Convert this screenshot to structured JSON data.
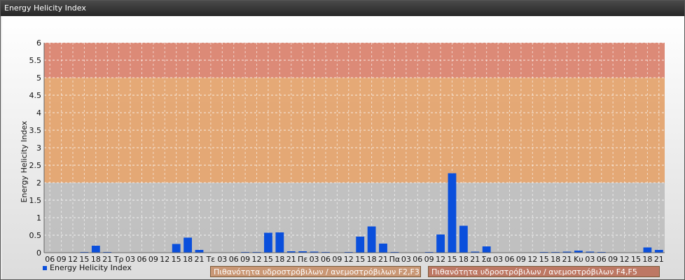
{
  "window": {
    "title": "Energy Helicity Index"
  },
  "legend": {
    "series_label": "Energy Helicity Index"
  },
  "bands": [
    {
      "label": "Πιθανότητα υδροστρόβιλων / ανεμοστρόβιλων F2,F3",
      "from": 2,
      "to": 5,
      "color": "#e3a26a"
    },
    {
      "label": "Πιθανότητα υδροστρόβιλων / ανεμοστρόβιλων F4,F5",
      "from": 5,
      "to": 6,
      "color": "#d9806b"
    }
  ],
  "colors": {
    "bar": "#0a4fdc",
    "band_low": "#bcbcbc"
  },
  "chart_data": {
    "type": "bar",
    "ylabel": "Energy Helicity Index",
    "ylim": [
      0,
      6
    ],
    "yticks": [
      "0",
      "0.5",
      "1",
      "1.5",
      "2",
      "2.5",
      "3",
      "3.5",
      "4",
      "4.5",
      "5",
      "5.5",
      "6"
    ],
    "grid": true,
    "legend_position": "bottom-left",
    "categories": [
      "06",
      "09",
      "12",
      "15",
      "18",
      "21",
      "Τρ",
      "03",
      "06",
      "09",
      "12",
      "15",
      "18",
      "21",
      "Τε",
      "03",
      "06",
      "09",
      "12",
      "15",
      "18",
      "21",
      "Πε",
      "03",
      "06",
      "09",
      "12",
      "15",
      "18",
      "21",
      "Πα",
      "03",
      "06",
      "09",
      "12",
      "15",
      "18",
      "21",
      "Σα",
      "03",
      "06",
      "09",
      "12",
      "15",
      "18",
      "21",
      "Κυ",
      "03",
      "06",
      "09",
      "12",
      "15",
      "18",
      "21"
    ],
    "values": [
      0.01,
      0.01,
      0.01,
      0.02,
      0.2,
      0.02,
      0.01,
      0.01,
      0.01,
      0.01,
      0.01,
      0.25,
      0.43,
      0.08,
      0.01,
      0.01,
      0.01,
      0.02,
      0.02,
      0.57,
      0.58,
      0.04,
      0.04,
      0.03,
      0.02,
      0.01,
      0.02,
      0.46,
      0.75,
      0.26,
      0.02,
      0.01,
      0.01,
      0.02,
      0.52,
      2.27,
      0.77,
      0.03,
      0.18,
      0.01,
      0.01,
      0.01,
      0.01,
      0.02,
      0.02,
      0.03,
      0.06,
      0.03,
      0.02,
      0.01,
      0.01,
      0.01,
      0.15,
      0.08
    ]
  }
}
